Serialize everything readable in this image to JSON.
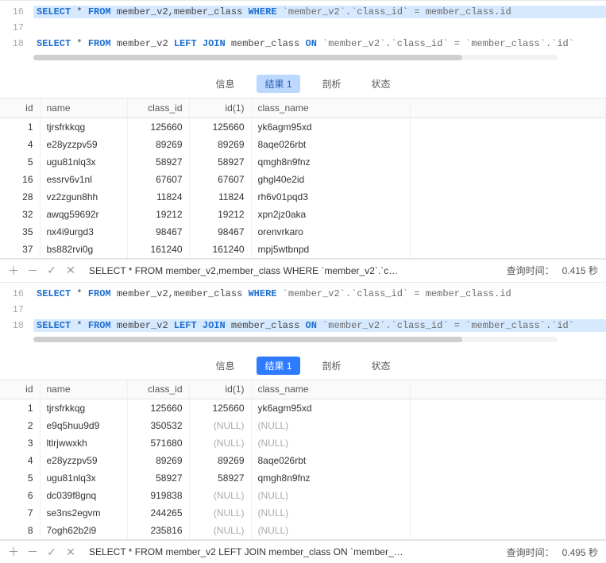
{
  "editor": {
    "lines": {
      "16": [
        {
          "t": "SELECT",
          "c": "kw"
        },
        {
          "t": " * ",
          "c": "pl"
        },
        {
          "t": "FROM",
          "c": "kw"
        },
        {
          "t": " member_v2,member_class ",
          "c": "pl"
        },
        {
          "t": "WHERE",
          "c": "kw"
        },
        {
          "t": " `member_v2`.`class_id` = member_class.id",
          "c": "cstr"
        }
      ],
      "17": [],
      "18": [
        {
          "t": "SELECT",
          "c": "kw"
        },
        {
          "t": " * ",
          "c": "pl"
        },
        {
          "t": "FROM",
          "c": "kw"
        },
        {
          "t": " member_v2 ",
          "c": "pl"
        },
        {
          "t": "LEFT JOIN",
          "c": "kw"
        },
        {
          "t": " member_class ",
          "c": "pl"
        },
        {
          "t": "ON",
          "c": "kw"
        },
        {
          "t": " `member_v2`.`class_id` = `member_class`.`id`",
          "c": "cstr"
        }
      ]
    }
  },
  "tabs": {
    "info": "信息",
    "result": "结果 1",
    "profile": "剖析",
    "status": "状态"
  },
  "columns": {
    "id": "id",
    "name": "name",
    "class_id": "class_id",
    "id1": "id(1)",
    "class_name": "class_name"
  },
  "null_text": "(NULL)",
  "panel1": {
    "highlight_line": "16",
    "tab_style": "light",
    "rows": [
      {
        "id": "1",
        "name": "tjrsfrkkqg",
        "class_id": "125660",
        "id1": "125660",
        "class_name": "yk6agm95xd"
      },
      {
        "id": "4",
        "name": "e28yzzpv59",
        "class_id": "89269",
        "id1": "89269",
        "class_name": "8aqe026rbt"
      },
      {
        "id": "5",
        "name": "ugu81nlq3x",
        "class_id": "58927",
        "id1": "58927",
        "class_name": "qmgh8n9fnz"
      },
      {
        "id": "16",
        "name": "essrv6v1nl",
        "class_id": "67607",
        "id1": "67607",
        "class_name": "ghgl40e2id"
      },
      {
        "id": "28",
        "name": "vz2zgun8hh",
        "class_id": "11824",
        "id1": "11824",
        "class_name": "rh6v01pqd3"
      },
      {
        "id": "32",
        "name": "awqg59692r",
        "class_id": "19212",
        "id1": "19212",
        "class_name": "xpn2jz0aka"
      },
      {
        "id": "35",
        "name": "nx4i9urgd3",
        "class_id": "98467",
        "id1": "98467",
        "class_name": "orenvrkaro"
      },
      {
        "id": "37",
        "name": "bs882rvi0g",
        "class_id": "161240",
        "id1": "161240",
        "class_name": "mpj5wtbnpd"
      }
    ],
    "footer_query": "SELECT * FROM member_v2,member_class WHERE `member_v2`.`c…",
    "footer_time_label": "查询时间：",
    "footer_time_value": "0.415 秒"
  },
  "panel2": {
    "highlight_line": "18",
    "tab_style": "solid",
    "rows": [
      {
        "id": "1",
        "name": "tjrsfrkkqg",
        "class_id": "125660",
        "id1": "125660",
        "class_name": "yk6agm95xd"
      },
      {
        "id": "2",
        "name": "e9q5huu9d9",
        "class_id": "350532",
        "id1": null,
        "class_name": null
      },
      {
        "id": "3",
        "name": "ltlrjwwxkh",
        "class_id": "571680",
        "id1": null,
        "class_name": null
      },
      {
        "id": "4",
        "name": "e28yzzpv59",
        "class_id": "89269",
        "id1": "89269",
        "class_name": "8aqe026rbt"
      },
      {
        "id": "5",
        "name": "ugu81nlq3x",
        "class_id": "58927",
        "id1": "58927",
        "class_name": "qmgh8n9fnz"
      },
      {
        "id": "6",
        "name": "dc039f8gnq",
        "class_id": "919838",
        "id1": null,
        "class_name": null
      },
      {
        "id": "7",
        "name": "se3ns2egvm",
        "class_id": "244265",
        "id1": null,
        "class_name": null
      },
      {
        "id": "8",
        "name": "7ogh62b2i9",
        "class_id": "235816",
        "id1": null,
        "class_name": null
      }
    ],
    "footer_query": "SELECT * FROM member_v2 LEFT JOIN member_class ON `member_…",
    "footer_time_label": "查询时间：",
    "footer_time_value": "0.495 秒"
  },
  "icons": {
    "plus": "＋",
    "minus": "－",
    "check": "✓",
    "close": "✕"
  }
}
